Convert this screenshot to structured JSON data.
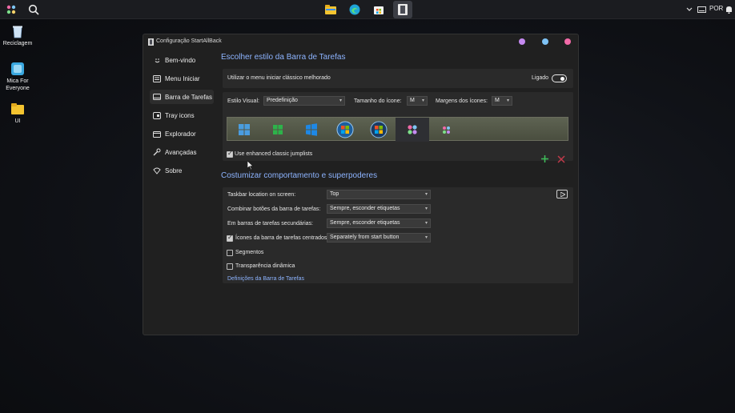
{
  "taskbar": {
    "tray": {
      "language": "POR"
    },
    "pinned": [
      "file-explorer-icon",
      "edge-icon",
      "store-icon",
      "startallback-icon"
    ]
  },
  "desktop": {
    "icons": [
      {
        "label": "Reciclagem"
      },
      {
        "label": "Mica For Everyone"
      },
      {
        "label": "UI"
      }
    ]
  },
  "window": {
    "title": "Configuração StartAllBack",
    "controls": {
      "colors": [
        "#c58af0",
        "#7fc3f5",
        "#f26aa8"
      ]
    },
    "sidebar": {
      "items": [
        {
          "label": "Bem-vindo",
          "icon": "smile-icon"
        },
        {
          "label": "Menu Iniciar",
          "icon": "start-menu-icon"
        },
        {
          "label": "Barra de Tarefas",
          "icon": "taskbar-icon",
          "active": true
        },
        {
          "label": "Tray icons",
          "icon": "tray-icon"
        },
        {
          "label": "Explorador",
          "icon": "folder-icon"
        },
        {
          "label": "Avançadas",
          "icon": "wrench-icon"
        },
        {
          "label": "Sobre",
          "icon": "about-icon"
        }
      ]
    },
    "section1": {
      "title": "Escolher estilo da Barra de Tarefas",
      "classic_menu_label": "Utilizar o menu iniciar clássico melhorado",
      "toggle_label": "Ligado",
      "toggle_on": true,
      "visual_style_label": "Estilo Visual:",
      "visual_style_value": "Predefinição",
      "icon_size_label": "Tamanho do ícone:",
      "icon_size_value": "M",
      "icon_margin_label": "Margens dos ícones:",
      "icon_margin_value": "M",
      "styles": [
        "win8-logo",
        "win-green",
        "win10-logo",
        "win7-orb",
        "vista-orb",
        "dots-pink",
        "dots-small"
      ],
      "selected_style": 5,
      "jumplists_label": "Use enhanced classic jumplists",
      "jumplists_checked": true
    },
    "section2": {
      "title": "Costumizar comportamento e superpoderes",
      "rows": [
        {
          "label": "Taskbar location on screen:",
          "value": "Top"
        },
        {
          "label": "Combinar botões da barra de tarefas:",
          "value": "Sempre, esconder etiquetas"
        },
        {
          "label": "Em barras de tarefas secundárias:",
          "value": "Sempre, esconder etiquetas"
        },
        {
          "label": "Ícones da barra de tarefas centrados",
          "value": "Separately from start button",
          "checked": true
        }
      ],
      "segments_label": "Segmentos",
      "segments_checked": false,
      "transparency_label": "Transparência dinâmica",
      "transparency_checked": false,
      "settings_link": "Definições da Barra de Tarefas"
    }
  }
}
